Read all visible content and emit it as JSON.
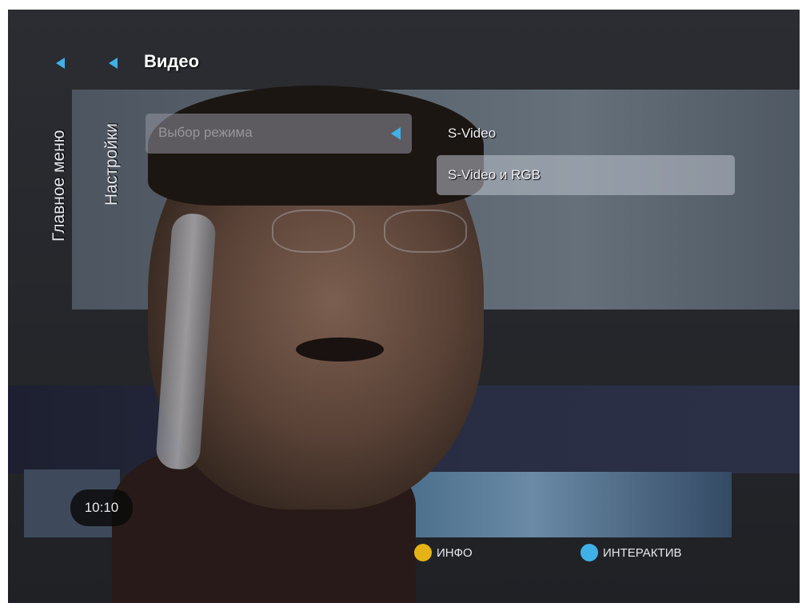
{
  "breadcrumb": {
    "main_menu": "Главное меню",
    "settings": "Настройки",
    "current": "Видео"
  },
  "setting": {
    "label": "Выбор режима"
  },
  "options": [
    {
      "label": "S-Video",
      "selected": false
    },
    {
      "label": "S-Video и RGB",
      "selected": true
    }
  ],
  "clock": "10:10",
  "hints": {
    "info": {
      "label": "ИНФО",
      "color": "#e6b316"
    },
    "interactive": {
      "label": "ИНТЕРАКТИВ",
      "color": "#3fb1e6"
    }
  },
  "colors": {
    "accent": "#3fb1e6"
  }
}
